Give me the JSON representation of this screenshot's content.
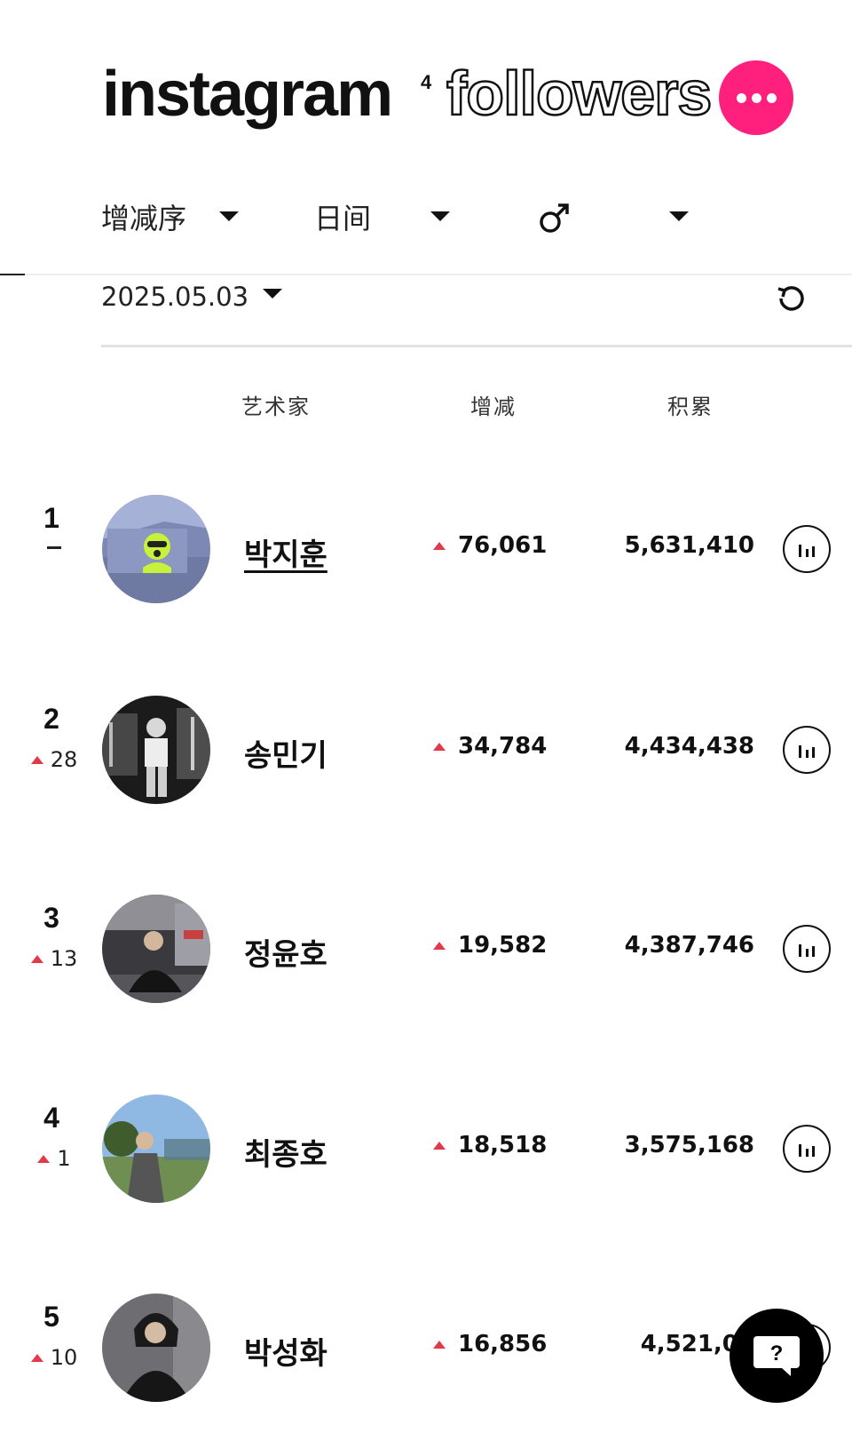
{
  "header": {
    "brand": "instagram",
    "brand_sup": "4",
    "brand_sub": "followers",
    "more_icon": "more-dots-icon",
    "more_color": "#ff1f7d"
  },
  "filters": {
    "sort_label": "增减序",
    "period_label": "日间",
    "gender_icon": "male-symbol-icon",
    "third_value": ""
  },
  "date": {
    "value": "2025.05.03",
    "refresh_icon": "refresh-icon"
  },
  "columns": {
    "artist": "艺术家",
    "change": "增减",
    "total": "积累"
  },
  "colors": {
    "up": "#e23a4a",
    "accent": "#ff1f7d"
  },
  "rows": [
    {
      "rank": "1",
      "rank_change": "–",
      "rank_dir": "same",
      "name": "박지훈",
      "delta": "76,061",
      "total": "5,631,410"
    },
    {
      "rank": "2",
      "rank_change": "28",
      "rank_dir": "up",
      "name": "송민기",
      "delta": "34,784",
      "total": "4,434,438"
    },
    {
      "rank": "3",
      "rank_change": "13",
      "rank_dir": "up",
      "name": "정윤호",
      "delta": "19,582",
      "total": "4,387,746"
    },
    {
      "rank": "4",
      "rank_change": "1",
      "rank_dir": "up",
      "name": "최종호",
      "delta": "18,518",
      "total": "3,575,168"
    },
    {
      "rank": "5",
      "rank_change": "10",
      "rank_dir": "up",
      "name": "박성화",
      "delta": "16,856",
      "total": "4,521,05"
    }
  ],
  "help": {
    "label": "?"
  }
}
